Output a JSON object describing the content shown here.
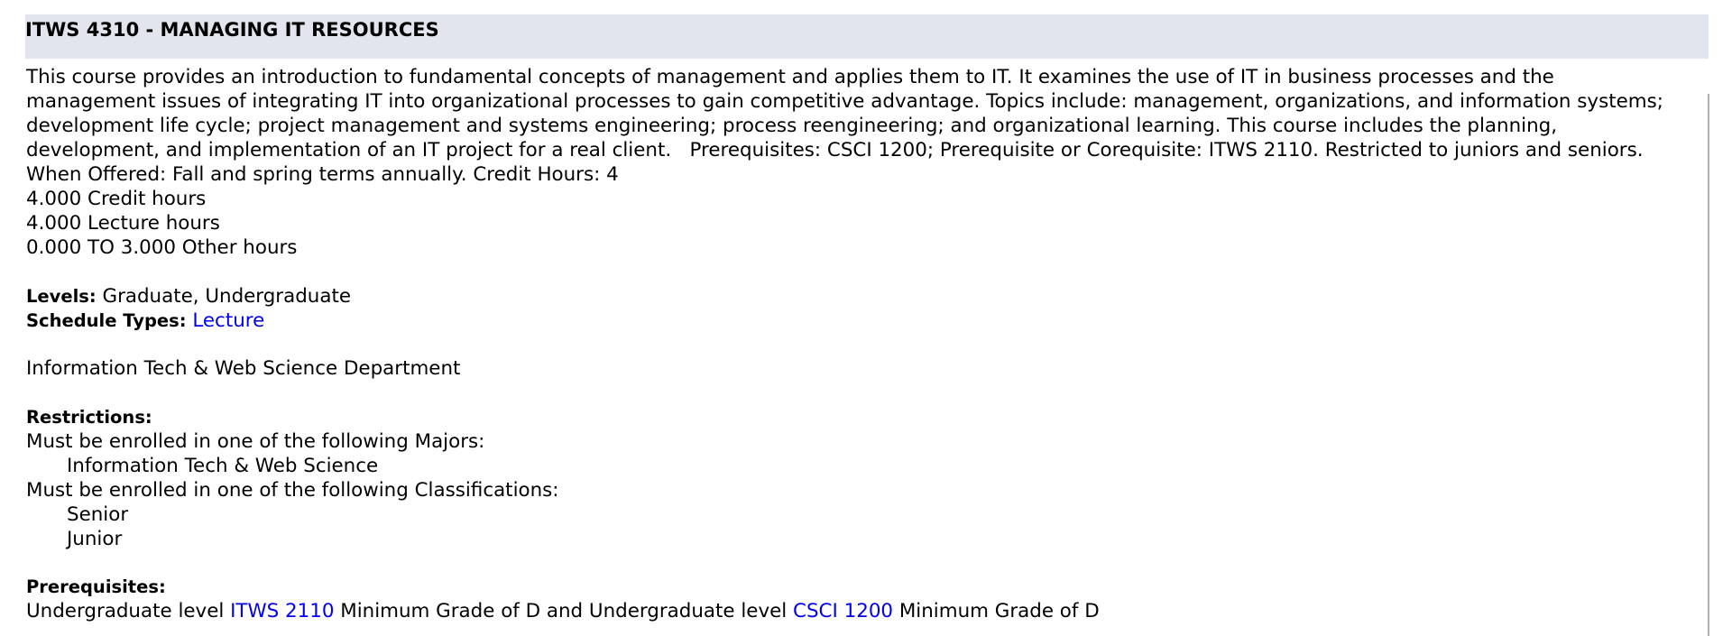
{
  "course": {
    "title": "ITWS 4310 - MANAGING IT RESOURCES",
    "description_lines": [
      "This course provides an introduction to fundamental concepts of management and applies them to IT. It examines the use of IT in business processes and the",
      "management issues of integrating IT into organizational processes to gain competitive advantage. Topics include: management, organizations, and information systems;",
      "development life cycle; project management and systems engineering; process reengineering; and organizational learning. This course includes the planning,",
      "development, and implementation of an IT project for a real client.   Prerequisites: CSCI 1200; Prerequisite or Corequisite: ITWS 2110. Restricted to juniors and seniors.",
      "When Offered: Fall and spring terms annually. Credit Hours: 4"
    ],
    "hours": {
      "credit": "4.000 Credit hours",
      "lecture": "4.000 Lecture hours",
      "other": "0.000 TO 3.000 Other hours"
    },
    "levels": {
      "label": "Levels:",
      "value": " Graduate, Undergraduate"
    },
    "schedule_types": {
      "label": "Schedule Types:",
      "link": "Lecture"
    },
    "department": "Information Tech & Web Science Department",
    "restrictions": {
      "label": "Restrictions:",
      "majors_intro": "Must be enrolled in one of the following Majors:",
      "majors": [
        "Information Tech & Web Science"
      ],
      "classifications_intro": "Must be enrolled in one of the following Classifications:",
      "classifications": [
        "Senior",
        "Junior"
      ]
    },
    "prerequisites": {
      "label": "Prerequisites:",
      "text_1": "Undergraduate level ",
      "link_1": "ITWS 2110",
      "text_2": " Minimum Grade of D and Undergraduate level ",
      "link_2": "CSCI 1200",
      "text_3": " Minimum Grade of D"
    }
  },
  "colors": {
    "title_background": "#e3e5ee",
    "link": "#0000ee",
    "text": "#000000"
  }
}
